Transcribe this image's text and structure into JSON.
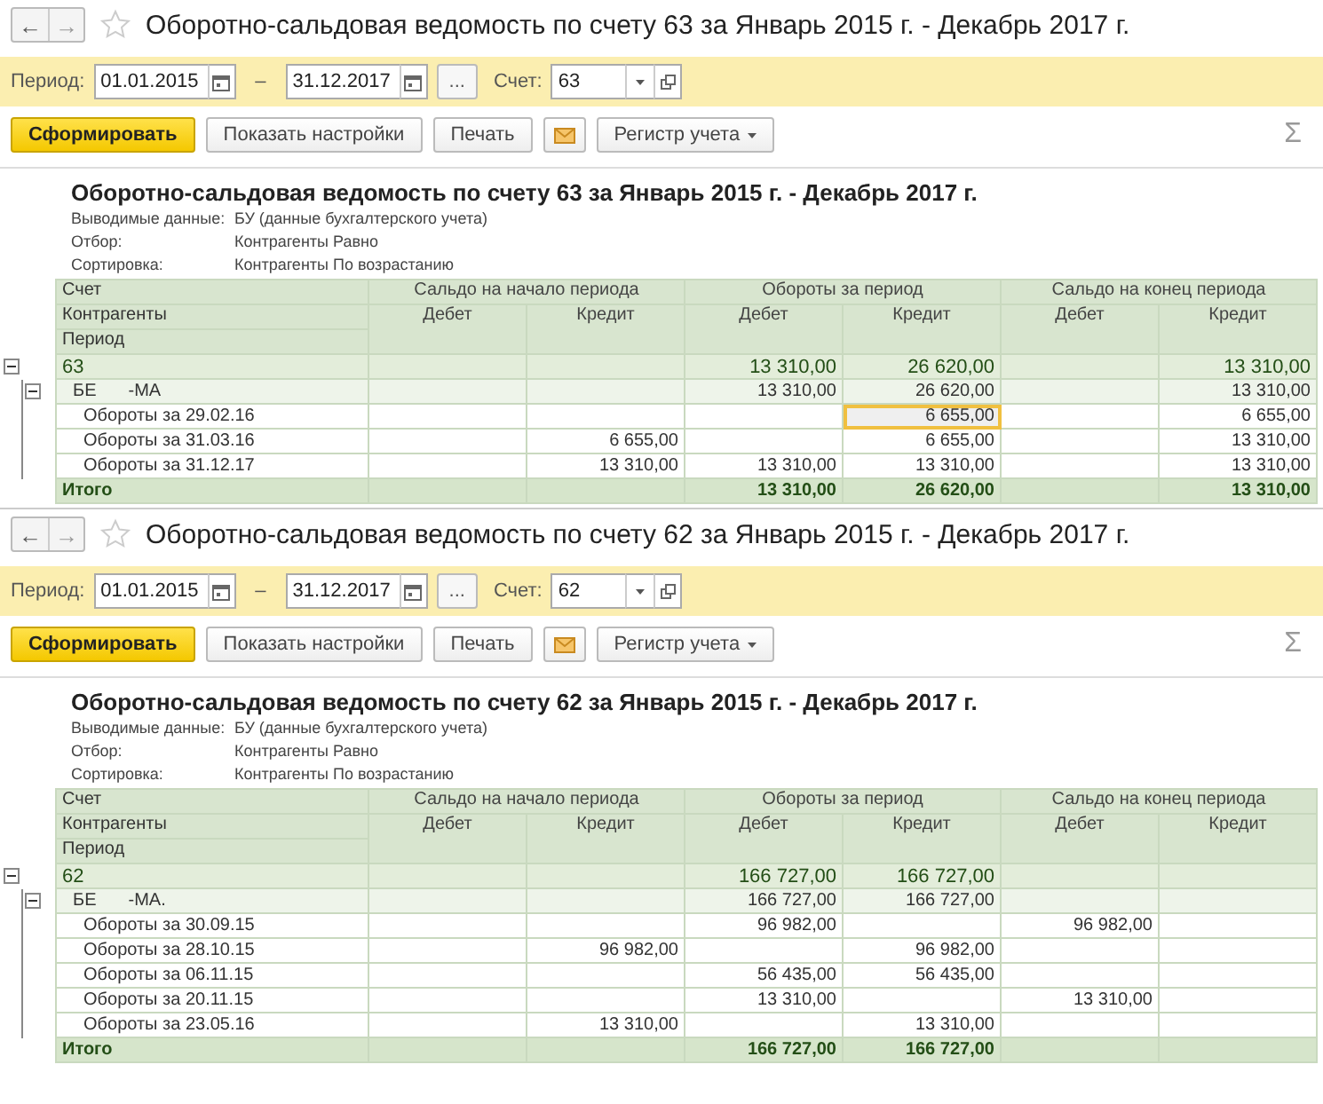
{
  "panels": [
    {
      "nav": {
        "back": "←",
        "forward": "→"
      },
      "favorite": false,
      "title": "Оборотно-сальдовая ведомость по счету 63 за Январь 2015 г. - Декабрь 2017 г.",
      "filters": {
        "period_label": "Период:",
        "date_from": "01.01.2015",
        "dash": "–",
        "date_to": "31.12.2017",
        "more": "...",
        "account_label": "Счет:",
        "account": "63"
      },
      "toolbar": [
        {
          "kind": "primary",
          "label": "Сформировать"
        },
        {
          "kind": "default",
          "label": "Показать настройки"
        },
        {
          "kind": "default",
          "label": "Печать"
        },
        {
          "kind": "mail"
        },
        {
          "kind": "dropdown",
          "label": "Регистр учета"
        }
      ],
      "sigma": "Σ",
      "report": {
        "title": "Оборотно-сальдовая ведомость по счету 63 за Январь 2015 г. - Декабрь 2017 г.",
        "info": [
          {
            "label": "Выводимые данные:",
            "value": "БУ (данные бухгалтерского учета)"
          },
          {
            "label": "Отбор:",
            "value": "Контрагенты Равно"
          },
          {
            "label": "Сортировка:",
            "value": "Контрагенты По возрастанию"
          }
        ],
        "left_headers": [
          "Счет",
          "Контрагенты",
          "Период"
        ],
        "groups": [
          {
            "title": "Сальдо на начало периода",
            "columns": [
              "Дебет",
              "Кредит"
            ]
          },
          {
            "title": "Обороты за период",
            "columns": [
              "Дебет",
              "Кредит"
            ]
          },
          {
            "title": "Сальдо на конец периода",
            "columns": [
              "Дебет",
              "Кредит"
            ]
          }
        ],
        "rows": [
          {
            "kind": "account",
            "label_parts": [
              "63"
            ],
            "expanded": true,
            "cells": [
              {
                "selected": false
              },
              {
                "selected": false
              },
              {
                "text": "13 310,00",
                "selected": false
              },
              {
                "text": "26 620,00",
                "selected": false
              },
              {
                "selected": false
              },
              {
                "text": "13 310,00",
                "selected": false
              }
            ],
            "children": [
              {
                "kind": "group",
                "label_parts": [
                  "БЕ",
                  "-МА"
                ],
                "expanded": true,
                "cells": [
                  {
                    "selected": false
                  },
                  {
                    "selected": false
                  },
                  {
                    "text": "13 310,00",
                    "selected": false
                  },
                  {
                    "text": "26 620,00",
                    "selected": false
                  },
                  {
                    "selected": false
                  },
                  {
                    "text": "13 310,00",
                    "selected": false
                  }
                ],
                "children": [
                  {
                    "kind": "period",
                    "label_parts": [
                      "Обороты за 29.02.16"
                    ],
                    "cells": [
                      {
                        "selected": false
                      },
                      {
                        "selected": false
                      },
                      {
                        "selected": false
                      },
                      {
                        "text": "6 655,00",
                        "selected": true
                      },
                      {
                        "selected": false
                      },
                      {
                        "text": "6 655,00",
                        "selected": false
                      }
                    ]
                  },
                  {
                    "kind": "period",
                    "label_parts": [
                      "Обороты за 31.03.16"
                    ],
                    "cells": [
                      {
                        "selected": false
                      },
                      {
                        "text": "6 655,00",
                        "selected": false
                      },
                      {
                        "selected": false
                      },
                      {
                        "text": "6 655,00",
                        "selected": false
                      },
                      {
                        "selected": false
                      },
                      {
                        "text": "13 310,00",
                        "selected": false
                      }
                    ]
                  },
                  {
                    "kind": "period",
                    "label_parts": [
                      "Обороты за 31.12.17"
                    ],
                    "cells": [
                      {
                        "selected": false
                      },
                      {
                        "text": "13 310,00",
                        "selected": false
                      },
                      {
                        "text": "13 310,00",
                        "selected": false
                      },
                      {
                        "text": "13 310,00",
                        "selected": false
                      },
                      {
                        "selected": false
                      },
                      {
                        "text": "13 310,00",
                        "selected": false
                      }
                    ]
                  }
                ]
              }
            ]
          }
        ],
        "total": {
          "label": "Итого",
          "cells": [
            {
              "selected": false
            },
            {
              "selected": false
            },
            {
              "text": "13 310,00",
              "selected": false
            },
            {
              "text": "26 620,00",
              "selected": false
            },
            {
              "selected": false
            },
            {
              "text": "13 310,00",
              "selected": false
            }
          ]
        }
      }
    },
    {
      "nav": {
        "back": "←",
        "forward": "→"
      },
      "favorite": false,
      "title": "Оборотно-сальдовая ведомость по счету 62 за Январь 2015 г. - Декабрь 2017 г.",
      "filters": {
        "period_label": "Период:",
        "date_from": "01.01.2015",
        "dash": "–",
        "date_to": "31.12.2017",
        "more": "...",
        "account_label": "Счет:",
        "account": "62"
      },
      "toolbar": [
        {
          "kind": "primary",
          "label": "Сформировать"
        },
        {
          "kind": "default",
          "label": "Показать настройки"
        },
        {
          "kind": "default",
          "label": "Печать"
        },
        {
          "kind": "mail"
        },
        {
          "kind": "dropdown",
          "label": "Регистр учета"
        }
      ],
      "sigma": "Σ",
      "report": {
        "title": "Оборотно-сальдовая ведомость по счету 62 за Январь 2015 г. - Декабрь 2017 г.",
        "info": [
          {
            "label": "Выводимые данные:",
            "value": "БУ (данные бухгалтерского учета)"
          },
          {
            "label": "Отбор:",
            "value": "Контрагенты Равно"
          },
          {
            "label": "Сортировка:",
            "value": "Контрагенты По возрастанию"
          }
        ],
        "left_headers": [
          "Счет",
          "Контрагенты",
          "Период"
        ],
        "groups": [
          {
            "title": "Сальдо на начало периода",
            "columns": [
              "Дебет",
              "Кредит"
            ]
          },
          {
            "title": "Обороты за период",
            "columns": [
              "Дебет",
              "Кредит"
            ]
          },
          {
            "title": "Сальдо на конец периода",
            "columns": [
              "Дебет",
              "Кредит"
            ]
          }
        ],
        "rows": [
          {
            "kind": "account",
            "label_parts": [
              "62"
            ],
            "expanded": true,
            "cells": [
              {
                "selected": false
              },
              {
                "selected": false
              },
              {
                "text": "166 727,00",
                "selected": false
              },
              {
                "text": "166 727,00",
                "selected": false
              },
              {
                "selected": false
              },
              {
                "selected": false
              }
            ],
            "children": [
              {
                "kind": "group",
                "label_parts": [
                  "БЕ",
                  "-МА."
                ],
                "expanded": true,
                "cells": [
                  {
                    "selected": false
                  },
                  {
                    "selected": false
                  },
                  {
                    "text": "166 727,00",
                    "selected": false
                  },
                  {
                    "text": "166 727,00",
                    "selected": false
                  },
                  {
                    "selected": false
                  },
                  {
                    "selected": false
                  }
                ],
                "children": [
                  {
                    "kind": "period",
                    "label_parts": [
                      "Обороты за 30.09.15"
                    ],
                    "cells": [
                      {
                        "selected": false
                      },
                      {
                        "selected": false
                      },
                      {
                        "text": "96 982,00",
                        "selected": false
                      },
                      {
                        "selected": false
                      },
                      {
                        "text": "96 982,00",
                        "selected": false
                      },
                      {
                        "selected": false
                      }
                    ]
                  },
                  {
                    "kind": "period",
                    "label_parts": [
                      "Обороты за 28.10.15"
                    ],
                    "cells": [
                      {
                        "selected": false
                      },
                      {
                        "text": "96 982,00",
                        "selected": false
                      },
                      {
                        "selected": false
                      },
                      {
                        "text": "96 982,00",
                        "selected": false
                      },
                      {
                        "selected": false
                      },
                      {
                        "selected": false
                      }
                    ]
                  },
                  {
                    "kind": "period",
                    "label_parts": [
                      "Обороты за 06.11.15"
                    ],
                    "cells": [
                      {
                        "selected": false
                      },
                      {
                        "selected": false
                      },
                      {
                        "text": "56 435,00",
                        "selected": false
                      },
                      {
                        "text": "56 435,00",
                        "selected": false
                      },
                      {
                        "selected": false
                      },
                      {
                        "selected": false
                      }
                    ]
                  },
                  {
                    "kind": "period",
                    "label_parts": [
                      "Обороты за 20.11.15"
                    ],
                    "cells": [
                      {
                        "selected": false
                      },
                      {
                        "selected": false
                      },
                      {
                        "text": "13 310,00",
                        "selected": false
                      },
                      {
                        "selected": false
                      },
                      {
                        "text": "13 310,00",
                        "selected": false
                      },
                      {
                        "selected": false
                      }
                    ]
                  },
                  {
                    "kind": "period",
                    "label_parts": [
                      "Обороты за 23.05.16"
                    ],
                    "cells": [
                      {
                        "selected": false
                      },
                      {
                        "text": "13 310,00",
                        "selected": false
                      },
                      {
                        "selected": false
                      },
                      {
                        "text": "13 310,00",
                        "selected": false
                      },
                      {
                        "selected": false
                      },
                      {
                        "selected": false
                      }
                    ]
                  }
                ]
              }
            ]
          }
        ],
        "total": {
          "label": "Итого",
          "cells": [
            {
              "selected": false
            },
            {
              "selected": false
            },
            {
              "text": "166 727,00",
              "selected": false
            },
            {
              "text": "166 727,00",
              "selected": false
            },
            {
              "selected": false
            },
            {
              "selected": false
            }
          ]
        }
      }
    }
  ]
}
